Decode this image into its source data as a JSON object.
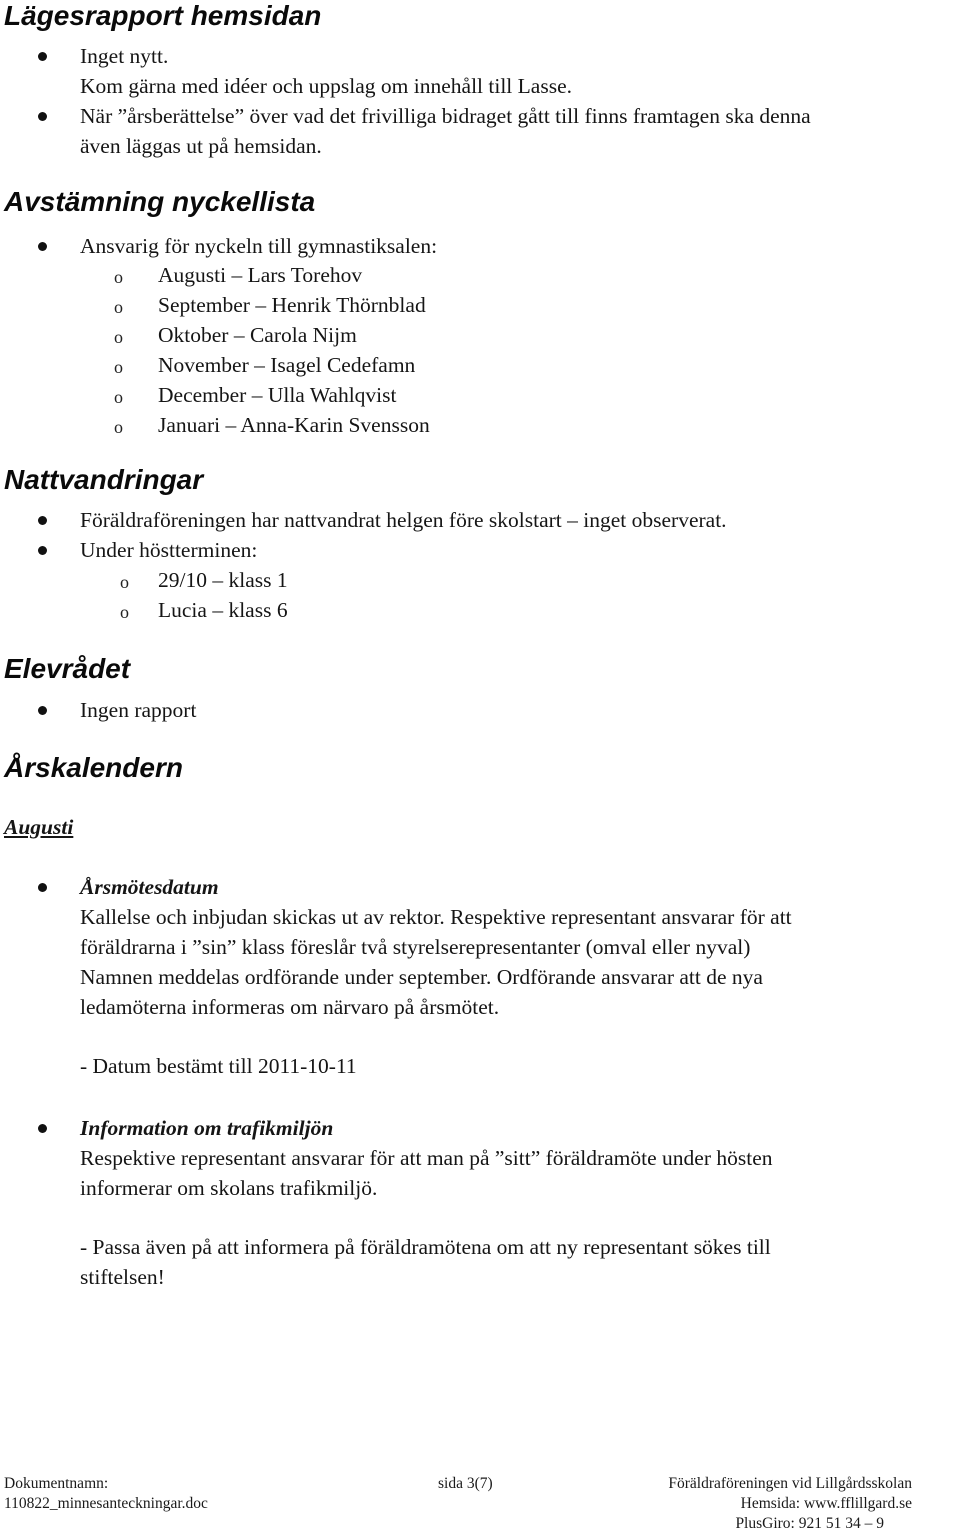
{
  "sections": {
    "hemsidan": {
      "heading": "Lägesrapport hemsidan",
      "items": [
        {
          "lines": [
            "Inget nytt.",
            "Kom gärna med idéer och uppslag om innehåll till Lasse."
          ]
        },
        {
          "lines": [
            "När ”årsberättelse” över vad det frivilliga bidraget gått till finns framtagen ska denna",
            "även läggas ut på hemsidan."
          ]
        }
      ]
    },
    "nyckellista": {
      "heading": "Avstämning nyckellista",
      "item": "Ansvarig för nyckeln till gymnastiksalen:",
      "subitems": [
        "Augusti – Lars Torehov",
        "September – Henrik Thörnblad",
        "Oktober – Carola Nijm",
        "November – Isagel Cedefamn",
        "December – Ulla Wahlqvist",
        "Januari – Anna-Karin Svensson"
      ]
    },
    "nattvandringar": {
      "heading": "Nattvandringar",
      "items": [
        "Föräldraföreningen har nattvandrat helgen före skolstart – inget observerat.",
        "Under höstterminen:"
      ],
      "subitems": [
        "29/10 – klass 1",
        "Lucia – klass 6"
      ]
    },
    "elevradet": {
      "heading": "Elevrådet",
      "items": [
        "Ingen rapport"
      ]
    },
    "arskalendern": {
      "heading": "Årskalendern",
      "month": "Augusti",
      "entries": [
        {
          "title": "Årsmötesdatum",
          "lines": [
            "Kallelse och inbjudan skickas ut av rektor. Respektive representant ansvarar för att",
            "föräldrarna i ”sin” klass föreslår två styrelserepresentanter (omval eller nyval)",
            "Namnen meddelas ordförande under september. Ordförande ansvarar att de nya",
            "ledamöterna informeras om närvaro på årsmötet."
          ],
          "note": "- Datum bestämt till 2011-10-11"
        },
        {
          "title": "Information om trafikmiljön",
          "lines": [
            "Respektive representant ansvarar för att man på ”sitt” föräldramöte under hösten",
            "informerar om skolans trafikmiljö."
          ],
          "note_lines": [
            "- Passa även på att informera på föräldramötena om att ny representant sökes till",
            "stiftelsen!"
          ]
        }
      ]
    }
  },
  "footer": {
    "doc_label": "Dokumentnamn:",
    "doc_name": "110822_minnesanteckningar.doc",
    "page": "sida 3(7)",
    "org": "Föräldraföreningen vid Lillgårdsskolan",
    "website": "Hemsida: www.fflillgard.se",
    "plusgiro": "PlusGiro: 921 51 34 – 9"
  }
}
